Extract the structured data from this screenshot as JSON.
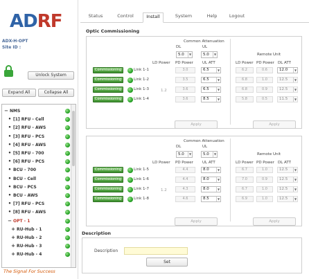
{
  "brand": {
    "logo_prefix": "AD",
    "logo_suffix": "RF",
    "model": "ADX-H-OPT",
    "site_label": "Site ID :",
    "tagline": "The Signal For Success"
  },
  "sidebar": {
    "unlock_label": "Unlock System",
    "expand_label": "Expand All",
    "collapse_label": "Collapse All",
    "tree": [
      {
        "label": "NMS",
        "expander": "−"
      },
      {
        "label": "[1] RFU - Cell",
        "expander": "•"
      },
      {
        "label": "[2] RFU - AWS",
        "expander": "•"
      },
      {
        "label": "[3] RFU - PCS",
        "expander": "•"
      },
      {
        "label": "[4] RFU - AWS",
        "expander": "•"
      },
      {
        "label": "[5] RFU - 700",
        "expander": "•"
      },
      {
        "label": "[6] RFU - PCS",
        "expander": "•"
      },
      {
        "label": "BCU - 700",
        "expander": "•"
      },
      {
        "label": "BCU - Cell",
        "expander": "•"
      },
      {
        "label": "BCU - PCS",
        "expander": "•"
      },
      {
        "label": "BCU - AWS",
        "expander": "•"
      },
      {
        "label": "[7] RFU - PCS",
        "expander": "•"
      },
      {
        "label": "[8] RFU - AWS",
        "expander": "•"
      },
      {
        "label": "OPT - 1",
        "expander": "−"
      },
      {
        "label": "RU-Hub - 1",
        "expander": "+"
      },
      {
        "label": "RU-Hub - 2",
        "expander": "+"
      },
      {
        "label": "RU-Hub - 3",
        "expander": "+"
      },
      {
        "label": "RU-Hub - 4",
        "expander": "+"
      }
    ]
  },
  "nav": {
    "tabs": [
      "Status",
      "Control",
      "Install",
      "System",
      "Help",
      "Logout"
    ],
    "active": "Install"
  },
  "optic": {
    "title": "Optic Commissioning",
    "common_attenuation": "Common Attenuation",
    "dl": "DL",
    "ul": "UL",
    "remote_unit": "Remote Unit",
    "ld_power": "LD Power",
    "pd_power": "PD Power",
    "ul_att": "UL ATT",
    "dl_att": "DL ATT",
    "commissioning": "Commissioning",
    "apply": "Apply",
    "groups": [
      {
        "dl_value": "5.0",
        "ul_value": "5.0",
        "ld_power": "1.2",
        "links": [
          {
            "name": "Link 1-1",
            "pd": "3.0",
            "ul_att": "6.5",
            "ru_ld": "6.2",
            "ru_pd": "0.6",
            "ru_dl": "12.0"
          },
          {
            "name": "Link 1-2",
            "pd": "3.5",
            "ul_att": "6.5",
            "ru_ld": "6.8",
            "ru_pd": "1.0",
            "ru_dl": "12.5"
          },
          {
            "name": "Link 1-3",
            "pd": "3.6",
            "ul_att": "6.5",
            "ru_ld": "6.8",
            "ru_pd": "0.9",
            "ru_dl": "12.5"
          },
          {
            "name": "Link 1-4",
            "pd": "3.6",
            "ul_att": "8.5",
            "ru_ld": "5.8",
            "ru_pd": "0.5",
            "ru_dl": "11.5"
          }
        ]
      },
      {
        "dl_value": "5.0",
        "ul_value": "5.0",
        "ld_power": "1.2",
        "links": [
          {
            "name": "Link 1-5",
            "pd": "4.4",
            "ul_att": "8.0",
            "ru_ld": "6.7",
            "ru_pd": "1.0",
            "ru_dl": "12.5"
          },
          {
            "name": "Link 1-6",
            "pd": "4.4",
            "ul_att": "8.0",
            "ru_ld": "7.0",
            "ru_pd": "0.9",
            "ru_dl": "12.5"
          },
          {
            "name": "Link 1-7",
            "pd": "4.3",
            "ul_att": "8.0",
            "ru_ld": "6.7",
            "ru_pd": "1.0",
            "ru_dl": "12.5"
          },
          {
            "name": "Link 1-8",
            "pd": "4.6",
            "ul_att": "8.5",
            "ru_ld": "6.9",
            "ru_pd": "1.0",
            "ru_dl": "12.5"
          }
        ]
      }
    ]
  },
  "description": {
    "title": "Description",
    "label": "Description",
    "value": "",
    "set_label": "Set"
  }
}
